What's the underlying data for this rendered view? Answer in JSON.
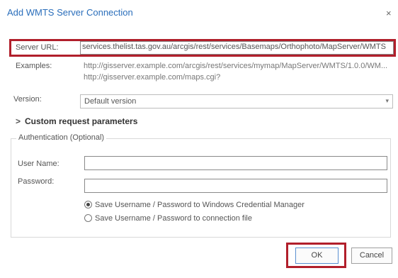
{
  "dialog": {
    "title": "Add WMTS Server Connection",
    "close_glyph": "×"
  },
  "server_url": {
    "label": "Server URL:",
    "value": "services.thelist.tas.gov.au/arcgis/rest/services/Basemaps/Orthophoto/MapServer/WMTS"
  },
  "examples": {
    "label": "Examples:",
    "lines": [
      "http://gisserver.example.com/arcgis/rest/services/mymap/MapServer/WMTS/1.0.0/WM...",
      "http://gisserver.example.com/maps.cgi?"
    ]
  },
  "version": {
    "label": "Version:",
    "selected": "Default version",
    "arrow_glyph": "▾"
  },
  "custom_request": {
    "chevron_glyph": ">",
    "label": "Custom request parameters"
  },
  "authentication": {
    "legend": "Authentication (Optional)",
    "user_name_label": "User Name:",
    "user_name_value": "",
    "password_label": "Password:",
    "password_value": "",
    "radio_options": [
      {
        "label": "Save Username / Password to Windows Credential Manager",
        "checked": true
      },
      {
        "label": "Save Username / Password to connection file",
        "checked": false
      }
    ]
  },
  "buttons": {
    "ok": "OK",
    "cancel": "Cancel"
  },
  "colors": {
    "title": "#2a6ebb",
    "highlight_border": "#b11f2b",
    "ok_border": "#5a8fd0"
  }
}
